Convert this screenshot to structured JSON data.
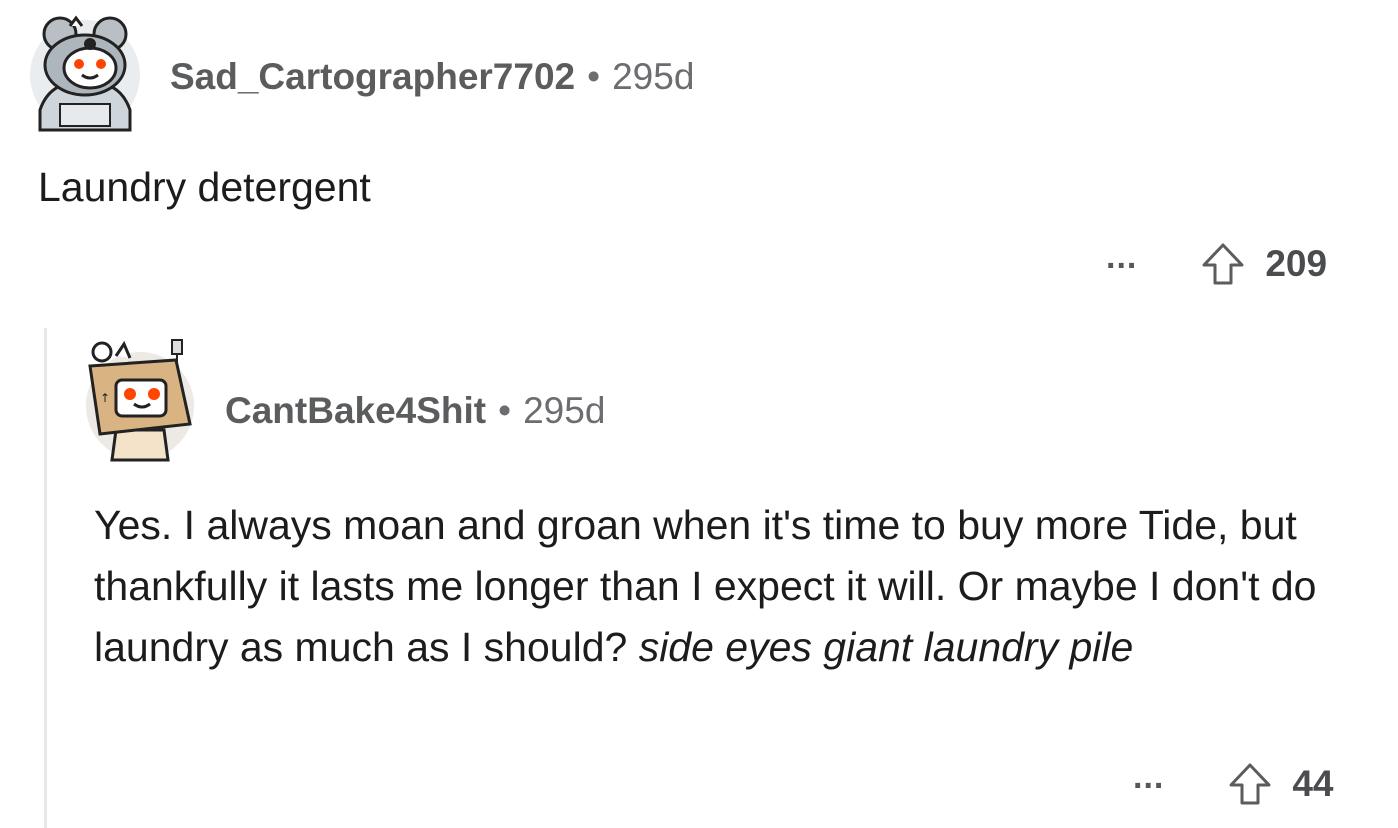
{
  "comments": [
    {
      "username": "Sad_Cartographer7702",
      "separator": "•",
      "age": "295d",
      "avatar_icon": "koala-snoo-avatar-icon",
      "body": "Laundry detergent",
      "more_label": "...",
      "upvote_icon": "upvote-arrow-icon",
      "score": "209"
    },
    {
      "username": "CantBake4Shit",
      "separator": "•",
      "age": "295d",
      "avatar_icon": "box-head-snoo-avatar-icon",
      "body_plain": "Yes. I always moan and groan when it's time to buy more Tide, but thankfully it lasts me longer than I expect it will. Or maybe I don't do laundry as much as I should? ",
      "body_italic": "side eyes giant laundry pile",
      "more_label": "...",
      "upvote_icon": "upvote-arrow-icon",
      "score": "44"
    }
  ],
  "colors": {
    "text": "#1c1c1c",
    "meta": "#5a5c5e",
    "thread_line": "#e6e8ea",
    "avatar_bg": "#e9edf0"
  }
}
